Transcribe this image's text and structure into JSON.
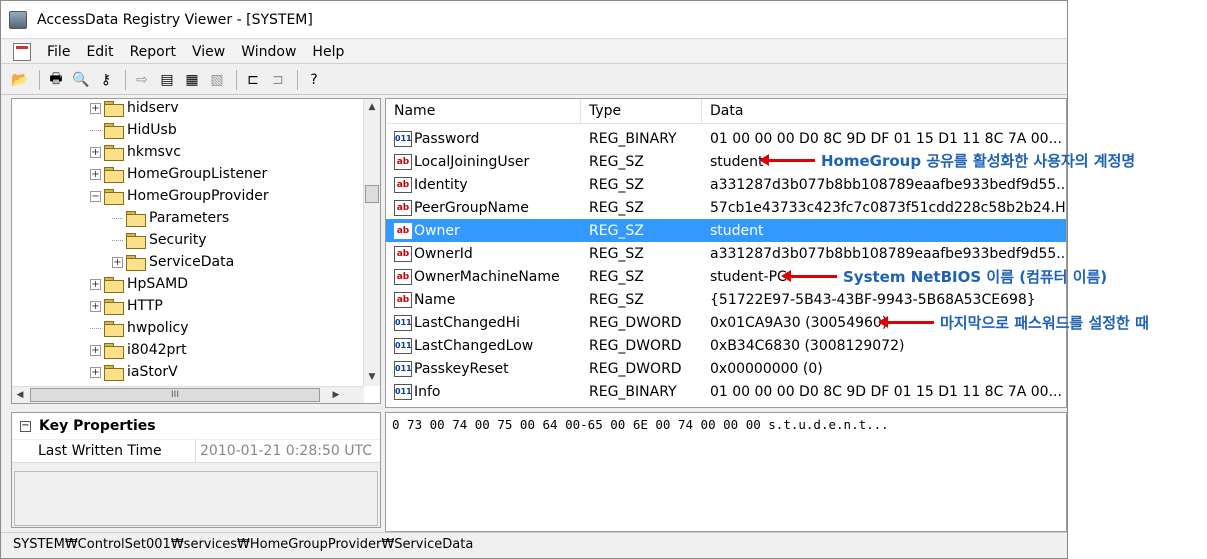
{
  "window": {
    "title": "AccessData Registry Viewer - [SYSTEM]"
  },
  "menu": [
    "File",
    "Edit",
    "Report",
    "View",
    "Window",
    "Help"
  ],
  "toolbar": [
    {
      "icon": "open-folder-icon",
      "glyph": "📂",
      "enabled": true
    },
    {
      "icon": "print-icon",
      "glyph": "🖶",
      "enabled": true
    },
    {
      "icon": "find-icon",
      "glyph": "🔍",
      "enabled": true
    },
    {
      "icon": "key-icon",
      "glyph": "⚷",
      "enabled": true
    },
    {
      "icon": "export-icon",
      "glyph": "⇨",
      "enabled": false
    },
    {
      "icon": "report-icon",
      "glyph": "▤",
      "enabled": true
    },
    {
      "icon": "report-add-icon",
      "glyph": "▦",
      "enabled": true
    },
    {
      "icon": "report-remove-icon",
      "glyph": "▧",
      "enabled": false
    },
    {
      "icon": "connect-icon",
      "glyph": "⊏",
      "enabled": true
    },
    {
      "icon": "disconnect-icon",
      "glyph": "⊐",
      "enabled": false
    },
    {
      "icon": "help-icon",
      "glyph": "?",
      "enabled": true
    }
  ],
  "tree": [
    {
      "label": "hidserv",
      "expander": "+",
      "level": 0
    },
    {
      "label": "HidUsb",
      "expander": "",
      "level": 0
    },
    {
      "label": "hkmsvc",
      "expander": "+",
      "level": 0
    },
    {
      "label": "HomeGroupListener",
      "expander": "+",
      "level": 0
    },
    {
      "label": "HomeGroupProvider",
      "expander": "−",
      "level": 0
    },
    {
      "label": "Parameters",
      "expander": "",
      "level": 1
    },
    {
      "label": "Security",
      "expander": "",
      "level": 1
    },
    {
      "label": "ServiceData",
      "expander": "+",
      "level": 1
    },
    {
      "label": "HpSAMD",
      "expander": "+",
      "level": 0
    },
    {
      "label": "HTTP",
      "expander": "+",
      "level": 0
    },
    {
      "label": "hwpolicy",
      "expander": "",
      "level": 0
    },
    {
      "label": "i8042prt",
      "expander": "+",
      "level": 0
    },
    {
      "label": "iaStorV",
      "expander": "+",
      "level": 0
    }
  ],
  "tree_scroll": {
    "h_thumb_label": "III"
  },
  "list": {
    "columns": [
      "Name",
      "Type",
      "Data"
    ],
    "rows": [
      {
        "name": "Password",
        "type": "REG_BINARY",
        "data": "01 00 00 00 D0 8C 9D DF 01 15 D1 11 8C 7A 00...",
        "kind": "bin"
      },
      {
        "name": "LocalJoiningUser",
        "type": "REG_SZ",
        "data": "student",
        "kind": "str"
      },
      {
        "name": "Identity",
        "type": "REG_SZ",
        "data": "a331287d3b077b8bb108789eaafbe933bedf9d55....",
        "kind": "str"
      },
      {
        "name": "PeerGroupName",
        "type": "REG_SZ",
        "data": "57cb1e43733c423fc7c0873f51cdd228c58b2b24.H...",
        "kind": "str"
      },
      {
        "name": "Owner",
        "type": "REG_SZ",
        "data": "student",
        "kind": "str",
        "selected": true
      },
      {
        "name": "OwnerId",
        "type": "REG_SZ",
        "data": "a331287d3b077b8bb108789eaafbe933bedf9d55....",
        "kind": "str"
      },
      {
        "name": "OwnerMachineName",
        "type": "REG_SZ",
        "data": "student-PC",
        "kind": "str"
      },
      {
        "name": "Name",
        "type": "REG_SZ",
        "data": "{51722E97-5B43-43BF-9943-5B68A53CE698}",
        "kind": "str"
      },
      {
        "name": "LastChangedHi",
        "type": "REG_DWORD",
        "data": "0x01CA9A30 (30054960)",
        "kind": "bin"
      },
      {
        "name": "LastChangedLow",
        "type": "REG_DWORD",
        "data": "0xB34C6830 (3008129072)",
        "kind": "bin"
      },
      {
        "name": "PasskeyReset",
        "type": "REG_DWORD",
        "data": "0x00000000 (0)",
        "kind": "bin"
      },
      {
        "name": "Info",
        "type": "REG_BINARY",
        "data": "01 00 00 00 D0 8C 9D DF 01 15 D1 11 8C 7A 00...",
        "kind": "bin"
      }
    ]
  },
  "properties": {
    "header": "Key Properties",
    "collapse_glyph": "−",
    "key": "Last Written Time",
    "value": "2010-01-21 0:28:50 UTC"
  },
  "hex": {
    "line": "0 73 00 74 00 75 00 64 00-65 00 6E 00 74 00 00 00 s.t.u.d.e.n.t..."
  },
  "statusbar": {
    "path": "SYSTEM₩ControlSet001₩services₩HomeGroupProvider₩ServiceData"
  },
  "annotations": [
    {
      "text": "HomeGroup 공유를 활성화한 사용자의 계정명"
    },
    {
      "text": "System NetBIOS 이름 (컴퓨터 이름)"
    },
    {
      "text": "마지막으로 패스워드를 설정한 때"
    }
  ],
  "colors": {
    "selection": "#3399ff",
    "arrow": "#e00000",
    "annotation": "#1f62b5"
  }
}
